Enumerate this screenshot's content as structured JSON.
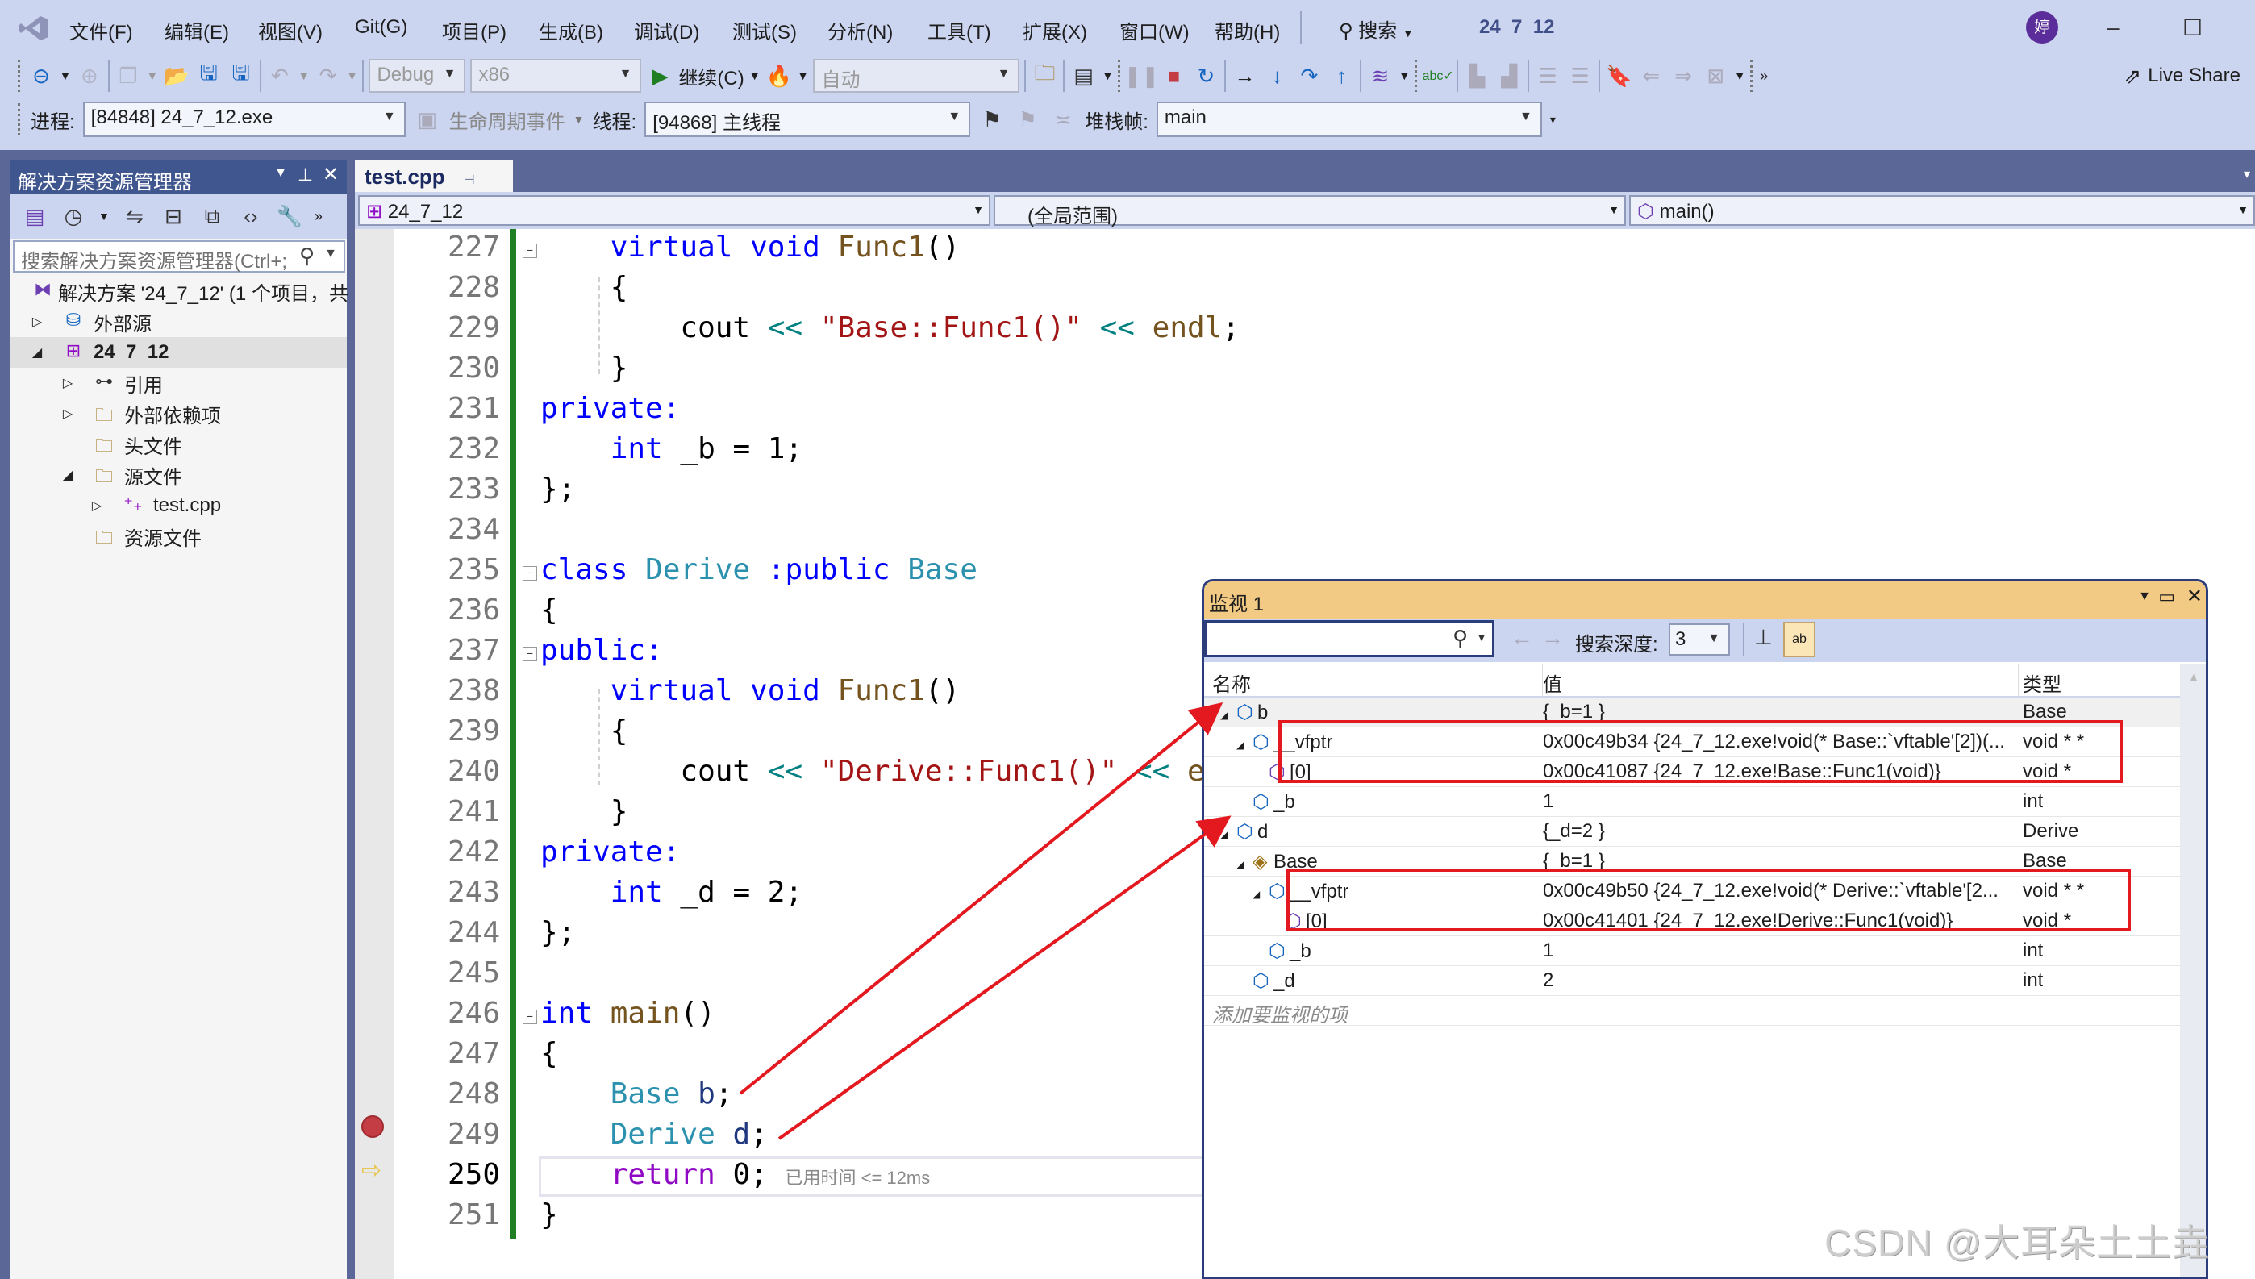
{
  "menubar": {
    "items": [
      "文件(F)",
      "编辑(E)",
      "视图(V)",
      "Git(G)",
      "项目(P)",
      "生成(B)",
      "调试(D)",
      "测试(S)",
      "分析(N)",
      "工具(T)",
      "扩展(X)",
      "窗口(W)",
      "帮助(H)"
    ],
    "search_label": "搜索",
    "solution_title": "24_7_12",
    "avatar_initial": "婷",
    "live_share": "Live Share"
  },
  "toolbar": {
    "config": "Debug",
    "platform": "x86",
    "continue_label": "继续(C)",
    "auto_combo": "自动"
  },
  "debug_location": {
    "process_label": "进程:",
    "process_value": "[84848] 24_7_12.exe",
    "lifecycle_label": "生命周期事件",
    "thread_label": "线程:",
    "thread_value": "[94868] 主线程",
    "stackframe_label": "堆栈帧:",
    "stackframe_value": "main"
  },
  "solution_explorer": {
    "title": "解决方案资源管理器",
    "search_placeholder": "搜索解决方案资源管理器(Ctrl+;",
    "items": [
      {
        "label": "解决方案 '24_7_12' (1 个项目，共",
        "icon": "solution-icon"
      },
      {
        "label": "外部源",
        "icon": "external-source-icon"
      },
      {
        "label": "24_7_12",
        "icon": "cpp-project-icon"
      },
      {
        "label": "引用",
        "icon": "references-icon"
      },
      {
        "label": "外部依赖项",
        "icon": "external-deps-icon"
      },
      {
        "label": "头文件",
        "icon": "filter-folder-icon"
      },
      {
        "label": "源文件",
        "icon": "filter-folder-icon"
      },
      {
        "label": "test.cpp",
        "icon": "cpp-file-icon"
      },
      {
        "label": "资源文件",
        "icon": "filter-folder-icon"
      }
    ]
  },
  "editor": {
    "tab": "test.cpp",
    "nav_project": "24_7_12",
    "nav_scope": "(全局范围)",
    "nav_member": "main()",
    "line_numbers": [
      "227",
      "228",
      "229",
      "230",
      "231",
      "232",
      "233",
      "234",
      "235",
      "236",
      "237",
      "238",
      "239",
      "240",
      "241",
      "242",
      "243",
      "244",
      "245",
      "246",
      "247",
      "248",
      "249",
      "250",
      "251"
    ],
    "current_line": "250",
    "breakpoint_line": "249",
    "elapsed": "已用时间 <= 12ms",
    "tokens": {
      "virtual": "virtual",
      "void": "void",
      "func1": "Func1",
      "parens": "()",
      "lbrace": "{",
      "rbrace": "}",
      "rbrace_semi": "};",
      "cout": "cout",
      "shl": "<<",
      "endl_semi": "endl;",
      "endl": "endl",
      "str_base": "\"Base::Func1()\"",
      "str_derive": "\"Derive::Func1()\"",
      "private": "private:",
      "public": "public:",
      "int": "int",
      "b_init": "_b = 1;",
      "d_init": "_d = 2;",
      "class": "class",
      "Derive": "Derive",
      "colon_public": ":public",
      "Base": "Base",
      "main": "main",
      "b": "b",
      "d": "d",
      "semi": ";",
      "return": "return",
      "zero_semi": "0;"
    }
  },
  "watch": {
    "title": "监视 1",
    "search_depth_label": "搜索深度:",
    "search_depth_value": "3",
    "columns": {
      "name": "名称",
      "value": "值",
      "type": "类型"
    },
    "rows": [
      {
        "name": "b",
        "value": "{_b=1 }",
        "type": "Base"
      },
      {
        "name": "__vfptr",
        "value": "0x00c49b34 {24_7_12.exe!void(* Base::`vftable'[2])(...",
        "type": "void * *"
      },
      {
        "name": "[0]",
        "value": "0x00c41087 {24_7_12.exe!Base::Func1(void)}",
        "type": "void *"
      },
      {
        "name": "_b",
        "value": "1",
        "type": "int"
      },
      {
        "name": "d",
        "value": "{_d=2 }",
        "type": "Derive"
      },
      {
        "name": "Base",
        "value": "{_b=1 }",
        "type": "Base"
      },
      {
        "name": "__vfptr",
        "value": "0x00c49b50 {24_7_12.exe!void(* Derive::`vftable'[2...",
        "type": "void * *"
      },
      {
        "name": "[0]",
        "value": "0x00c41401 {24_7_12.exe!Derive::Func1(void)}",
        "type": "void *"
      },
      {
        "name": "_b",
        "value": "1",
        "type": "int"
      },
      {
        "name": "_d",
        "value": "2",
        "type": "int"
      }
    ],
    "add_item_placeholder": "添加要监视的项"
  },
  "watermark": "CSDN @大耳朵土土垚",
  "colors": {
    "annotation_red": "#e3191f",
    "watch_title": "#f2ca84",
    "accent": "#40568e"
  }
}
